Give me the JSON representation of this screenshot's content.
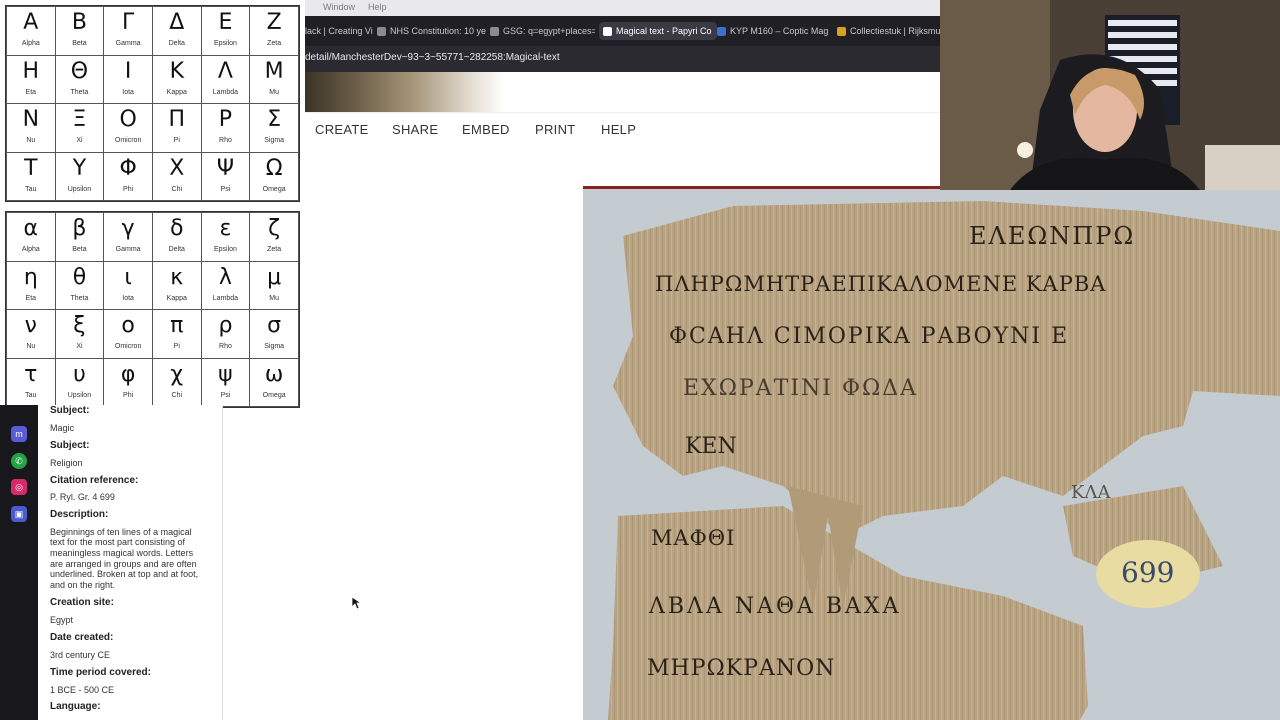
{
  "menubar": {
    "window": "Window",
    "help": "Help"
  },
  "tabs": [
    {
      "label": "lack | Creating Vi",
      "active": false
    },
    {
      "label": "NHS Constitution: 10 ye",
      "active": false
    },
    {
      "label": "GSG: q=egypt+places=",
      "active": false
    },
    {
      "label": "Magical text - Papyri Co",
      "active": true
    },
    {
      "label": "KYP M160 – Coptic Mag",
      "active": false
    },
    {
      "label": "Collectiestuk | Rijksmus",
      "active": false
    }
  ],
  "url": "detail/ManchesterDev~93~3~55771~282258:Magical-text",
  "nav": {
    "create": "CREATE",
    "share": "SHARE",
    "embed": "EMBED",
    "print": "PRINT",
    "help": "HELP"
  },
  "greek_upper": [
    [
      {
        "l": "Α",
        "n": "Alpha"
      },
      {
        "l": "Β",
        "n": "Beta"
      },
      {
        "l": "Γ",
        "n": "Gamma"
      },
      {
        "l": "Δ",
        "n": "Delta"
      },
      {
        "l": "Ε",
        "n": "Epsilon"
      },
      {
        "l": "Ζ",
        "n": "Zeta"
      }
    ],
    [
      {
        "l": "Η",
        "n": "Eta"
      },
      {
        "l": "Θ",
        "n": "Theta"
      },
      {
        "l": "Ι",
        "n": "Iota"
      },
      {
        "l": "Κ",
        "n": "Kappa"
      },
      {
        "l": "Λ",
        "n": "Lambda"
      },
      {
        "l": "Μ",
        "n": "Mu"
      }
    ],
    [
      {
        "l": "Ν",
        "n": "Nu"
      },
      {
        "l": "Ξ",
        "n": "Xi"
      },
      {
        "l": "Ο",
        "n": "Omicron"
      },
      {
        "l": "Π",
        "n": "Pi"
      },
      {
        "l": "Ρ",
        "n": "Rho"
      },
      {
        "l": "Σ",
        "n": "Sigma"
      }
    ],
    [
      {
        "l": "Τ",
        "n": "Tau"
      },
      {
        "l": "Υ",
        "n": "Upsilon"
      },
      {
        "l": "Φ",
        "n": "Phi"
      },
      {
        "l": "Χ",
        "n": "Chi"
      },
      {
        "l": "Ψ",
        "n": "Psi"
      },
      {
        "l": "Ω",
        "n": "Omega"
      }
    ]
  ],
  "greek_lower": [
    [
      {
        "l": "α",
        "n": "Alpha"
      },
      {
        "l": "β",
        "n": "Beta"
      },
      {
        "l": "γ",
        "n": "Gamma"
      },
      {
        "l": "δ",
        "n": "Delta"
      },
      {
        "l": "ε",
        "n": "Epsilon"
      },
      {
        "l": "ζ",
        "n": "Zeta"
      }
    ],
    [
      {
        "l": "η",
        "n": "Eta"
      },
      {
        "l": "θ",
        "n": "Theta"
      },
      {
        "l": "ι",
        "n": "Iota"
      },
      {
        "l": "κ",
        "n": "Kappa"
      },
      {
        "l": "λ",
        "n": "Lambda"
      },
      {
        "l": "μ",
        "n": "Mu"
      }
    ],
    [
      {
        "l": "ν",
        "n": "Nu"
      },
      {
        "l": "ξ",
        "n": "Xi"
      },
      {
        "l": "ο",
        "n": "Omicron"
      },
      {
        "l": "π",
        "n": "Pi"
      },
      {
        "l": "ρ",
        "n": "Rho"
      },
      {
        "l": "σ",
        "n": "Sigma"
      }
    ],
    [
      {
        "l": "τ",
        "n": "Tau"
      },
      {
        "l": "υ",
        "n": "Upsilon"
      },
      {
        "l": "φ",
        "n": "Phi"
      },
      {
        "l": "χ",
        "n": "Chi"
      },
      {
        "l": "ψ",
        "n": "Psi"
      },
      {
        "l": "ω",
        "n": "Omega"
      }
    ]
  ],
  "sidebar_apps": [
    "messenger-icon",
    "whatsapp-icon",
    "instagram-icon",
    "app-icon"
  ],
  "metadata": {
    "subject_label_top": "Subject:",
    "subject1": "Magic",
    "subject_label": "Subject:",
    "subject2": "Religion",
    "citation_label": "Citation reference:",
    "citation": "P. Ryl. Gr. 4 699",
    "description_label": "Description:",
    "description_lines": [
      "Beginnings of ten lines of a magical",
      "text for the most part consisting of",
      "meaningless magical words. Letters",
      "are arranged in groups and are often",
      "underlined. Broken at top and at foot,",
      "and on the right."
    ],
    "creation_site_label": "Creation site:",
    "creation_site": "Egypt",
    "date_created_label": "Date created:",
    "date_created": "3rd century CE",
    "time_period_label": "Time period covered:",
    "time_period": "1 BCE - 500 CE",
    "language_label": "Language:"
  },
  "papyrus": {
    "lines": [
      "ΕΛΕΩΝΠΡΩ",
      "ΠΛΗΡΩΜΗΤΡΑΕΠΙΚΑΛΟΜΕΝΕ ΚΑΡΒΑ",
      "ΦCΑΗΛ CΙΜΟΡΙΚΑ ΡΑΒΟΥΝΙ Ε",
      "ΕΧΩΡΑΤΙΝΙ ΦΩΔΑ",
      "ΚΕΝ",
      "ΚΛΑ",
      "ΜΑΦΘΙ",
      "ΛΒΛΑ ΝΑΘΑ ΒΑΧΑ",
      "ΜΗΡΩΚΡΑΝΟΝ"
    ],
    "label": "699"
  },
  "colors": {
    "accent_red": "#8a2222",
    "tab_bg": "#1f1f24",
    "papyrus": "#b8a382"
  }
}
